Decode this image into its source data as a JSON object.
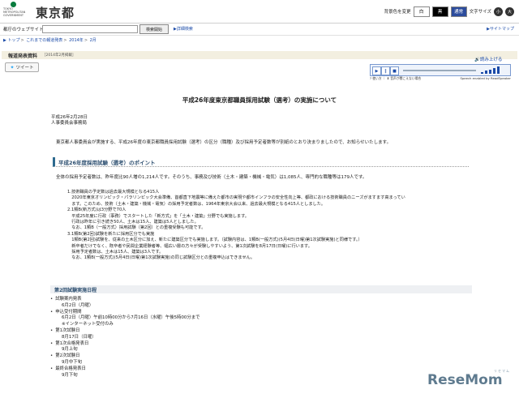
{
  "header": {
    "logo_sub": "TOKYO METROPOLITAN GOVERNMENT",
    "logo_ja": "東京都",
    "bg_label": "背景色を変更",
    "colors": [
      {
        "label": "白",
        "color": "#ffffff"
      },
      {
        "label": "黒",
        "color": "#000000"
      },
      {
        "label": "通常",
        "color": "#2c4c9c"
      }
    ],
    "font_label": "文字サイズ",
    "font_sizes": [
      "小",
      "大"
    ]
  },
  "search": {
    "label": "都庁のウェブサイトからさがす",
    "value": "",
    "button": "検索開始",
    "advanced": "詳細検索",
    "sitemap": "サイトマップ"
  },
  "breadcrumb": [
    "トップ",
    "これまでの報道発表",
    "2014年",
    "2月"
  ],
  "press": {
    "title": "報道発表資料",
    "date": "［2014年2月掲載］"
  },
  "tweet": "ツイート",
  "readspeaker": {
    "read_label": "読み上げる",
    "help": "使い方",
    "download": "音声が聞こえない場合",
    "brand": "Speech enabled by ReadSpeaker"
  },
  "doc": {
    "title": "平成26年度東京都職員採用試験（選考）の実施について",
    "date": "平成26年2月28日",
    "office": "人事委員会事務局",
    "intro": "東京都人事委員会が実施する、平成26年度の東京都職員採用試験（選考）の区分（職種）及び採用予定者数等が別紙のとおり決まりましたので、お知らせいたします。",
    "h2": "平成26年度採用試験（選考）のポイント",
    "p1": "全体の採用予定者数は、昨年度比90人増の1,214人です。そのうち、事務及び技術（土木・建築・機械・電気）は1,085人、専門的な職種等は179人です。",
    "points": [
      "1.技術職員の予定数は過去最大規模となる415人",
      "　2020年東京オリンピック・パラリンピック大会準備、首都直下地震等に備えた都市の実現や都市インフラの安全性向上等、都政における技術職員のニーズがますます高まってい",
      "　ます。このため、技術（土木・建築・機械・電気）の採用予定者数は、1964年東京大会以来、過去最大規模となる415人としました。",
      "2.1類B(新方式)は3分野で70人",
      "　平成25年度に行政（事務）でスタートした「新方式」を「土木・建築」分野でも実施します。",
      "　行政は昨年に引き続き50人、土木は15人、建築は5人としました。",
      "　なお、1類B（一般方式）採用試験（第2回）との重複受験も可能です。",
      "3.1類B(第2回)試験を新たに採用区分でも実施",
      "　1類B(第2回)試験を、従来の土木区分に加え、新たに建築区分でも実施します。（試験内容は、1類B(一般方式)(5月4日(日曜)第1次試験実施)と同様です。）",
      "　新卒者だけでなく、既卒者や民間企業経験者等、幅広い層の方々が受験しやすいよう、第1次試験を8月17日(日曜)に行います。",
      "　採用予定者数は、土木は15人、建築は3人です。",
      "　なお、1類B(一般方式)(5月4日(日曜)第1次試験実施)の同じ試験区分との重複申込はできません。"
    ],
    "h3": "第2回試験実施日程",
    "schedule": [
      {
        "b": "試験案内発表",
        "s": [
          "6月2日（月曜）"
        ]
      },
      {
        "b": "申込受付期間",
        "s": [
          "6月2日（月曜）午前10時00分から7月16日（水曜）午後5時00分まで",
          "※インターネット受付のみ"
        ]
      },
      {
        "b": "第1次試験日",
        "s": [
          "8月17日（日曜）"
        ]
      },
      {
        "b": "第1次合格発表日",
        "s": [
          "9月上旬"
        ]
      },
      {
        "b": "第2次試験日",
        "s": [
          "9月中下旬"
        ]
      },
      {
        "b": "最終合格発表日",
        "s": [
          "9月下旬"
        ]
      }
    ]
  },
  "watermark": {
    "brand": "ReseMom",
    "sub": "リセマム"
  }
}
